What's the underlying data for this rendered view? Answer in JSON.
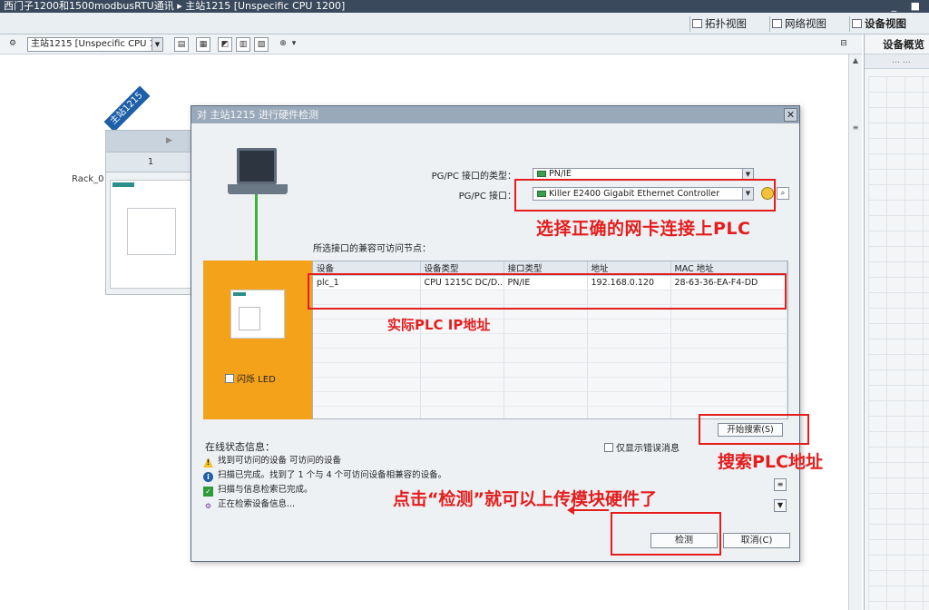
{
  "title_bar": {
    "text": "西门子1200和1500modbusRTU通讯  ▸  主站1215 [Unspecific CPU 1200]",
    "window_controls": "_ ■"
  },
  "view_tabs": {
    "topology": "拓扑视图",
    "network": "网络视图",
    "device": "设备视图"
  },
  "toolbar": {
    "device_select": "主站1215 [Unspecific CPU 12("
  },
  "right_panel": {
    "header": "设备概览"
  },
  "rack": {
    "tag": "主站1215",
    "label": "Rack_0",
    "slot_number": "1"
  },
  "dialog": {
    "title": "对 主站1215 进行硬件检测",
    "close_glyph": "✕",
    "pg_pc_type_label": "PG/PC 接口的类型：",
    "pg_pc_type_value": "PN/IE",
    "pg_pc_interface_label": "PG/PC 接口：",
    "pg_pc_interface_value": "Killer E2400 Gigabit Ethernet Controller",
    "nodes_label": "所选接口的兼容可访问节点：",
    "flash_led": "闪烁 LED",
    "table": {
      "headers": [
        "设备",
        "设备类型",
        "接口类型",
        "地址",
        "MAC 地址"
      ],
      "rows": [
        [
          "plc_1",
          "CPU 1215C DC/D...",
          "PN/IE",
          "192.168.0.120",
          "28-63-36-EA-F4-DD"
        ]
      ]
    },
    "start_search": "开始搜索(S)",
    "status_label": "在线状态信息：",
    "errors_only": "仅显示错误消息",
    "status_messages": [
      {
        "icon": "warning",
        "text": "找到可访问的设备 可访问的设备"
      },
      {
        "icon": "info",
        "text": "扫描已完成。找到了 1 个与 4 个可访问设备相兼容的设备。"
      },
      {
        "icon": "ok",
        "text": "扫描与信息检索已完成。"
      },
      {
        "icon": "busy",
        "text": "正在检索设备信息..."
      }
    ],
    "detect_button": "检测",
    "cancel_button": "取消(C)"
  },
  "annotations": {
    "nic": "选择正确的网卡连接上PLC",
    "ip": "实际PLC  IP地址",
    "search": "搜索PLC地址",
    "detect": "点击“检测”就可以上传模块硬件了"
  },
  "colors": {
    "annotation_red": "#e41d1d",
    "target_panel": "#f5a21b",
    "link_green": "#3fb03a"
  }
}
